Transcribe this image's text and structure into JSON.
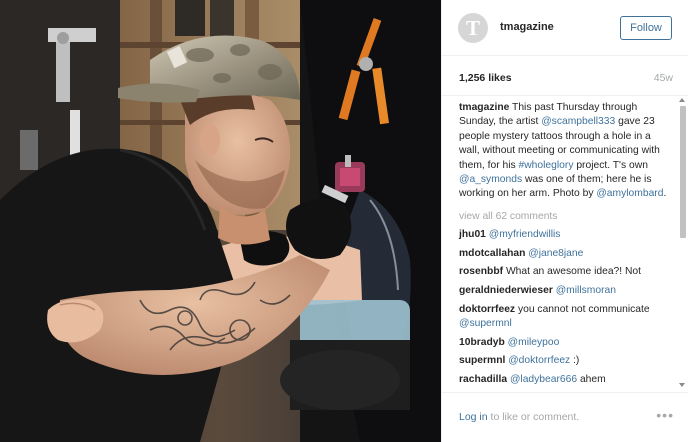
{
  "post": {
    "username": "tmagazine",
    "avatar_letter": "T",
    "follow_label": "Follow",
    "likes": "1,256 likes",
    "time_ago": "45w"
  },
  "caption": {
    "author": "tmagazine",
    "parts": {
      "t1": " This past Thursday through Sunday, the artist ",
      "m1": "@scampbell333",
      "t2": " gave 23 people mystery tattoos through a hole in a wall, without meeting or communicating with them, for his ",
      "m2": "#wholeglory",
      "t3": " project. T's own ",
      "m3": "@a_symonds",
      "t4": " was one of them; here he is working on her arm. Photo by ",
      "m4": "@amylombard",
      "t5": "."
    }
  },
  "view_all_comments": "view all 62 comments",
  "comments": [
    {
      "user": "jhu01",
      "text": "",
      "mention": "@myfriendwillis"
    },
    {
      "user": "mdotcallahan",
      "text": "",
      "mention": "@jane8jane"
    },
    {
      "user": "rosenbbf",
      "text": "What an awesome idea?! Not",
      "mention": ""
    },
    {
      "user": "geraldniederwieser",
      "text": "",
      "mention": "@millsmoran"
    },
    {
      "user": "doktorrfeez",
      "text": "you cannot not communicate",
      "mention": "@supermnl"
    },
    {
      "user": "10bradyb",
      "text": "",
      "mention": "@mileypoo"
    },
    {
      "user": "supermnl",
      "text": "",
      "mention": "@doktorrfeez",
      "tail": " :)"
    },
    {
      "user": "rachadilla",
      "text": "",
      "mention": "@ladybear666",
      "tail": " ahem"
    }
  ],
  "footer": {
    "login_link": "Log in",
    "login_rest": " to like or comment.",
    "more": "•••"
  },
  "colors": {
    "accent": "#3f729b",
    "muted": "#a5a7aa",
    "text": "#262626"
  },
  "icons": [
    "more-options-icon",
    "scroll-up-icon",
    "scroll-down-icon"
  ]
}
